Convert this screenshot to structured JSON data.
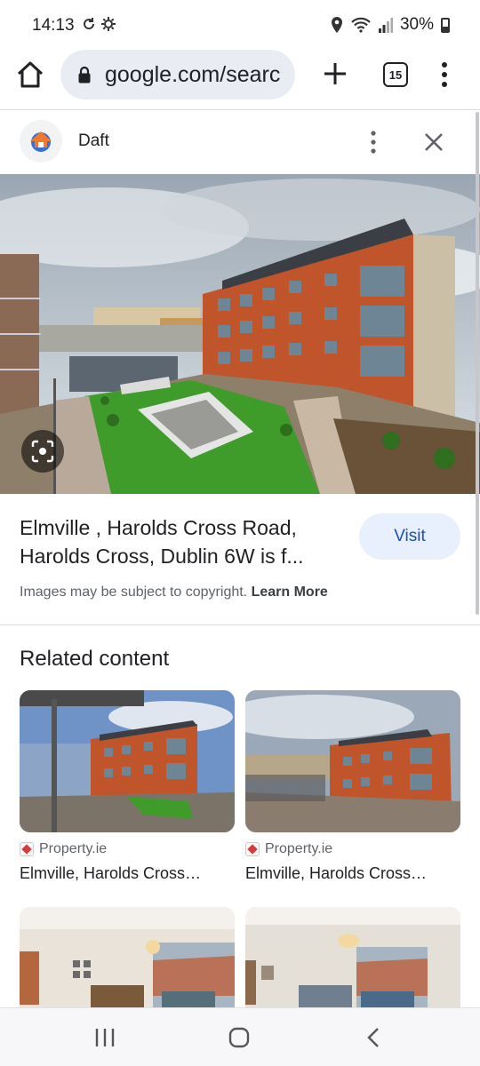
{
  "status_bar": {
    "time": "14:13",
    "battery": "30%"
  },
  "browser": {
    "url": "google.com/searc",
    "tab_count": "15"
  },
  "source": {
    "name": "Daft"
  },
  "result": {
    "title": "Elmville , Harolds Cross Road, Harolds Cross, Dublin 6W is f...",
    "visit_label": "Visit",
    "copyright_text": "Images may be subject to copyright.",
    "learn_more_label": "Learn More"
  },
  "related": {
    "heading": "Related content",
    "cards": [
      {
        "source": "Property.ie",
        "title": "Elmville, Harolds Cross…"
      },
      {
        "source": "Property.ie",
        "title": "Elmville, Harolds Cross…"
      }
    ]
  },
  "colors": {
    "visit_bg": "#e8f0fe",
    "visit_text": "#1a4fb4",
    "brick": "#c0552b",
    "lawn": "#3f9b2a"
  }
}
